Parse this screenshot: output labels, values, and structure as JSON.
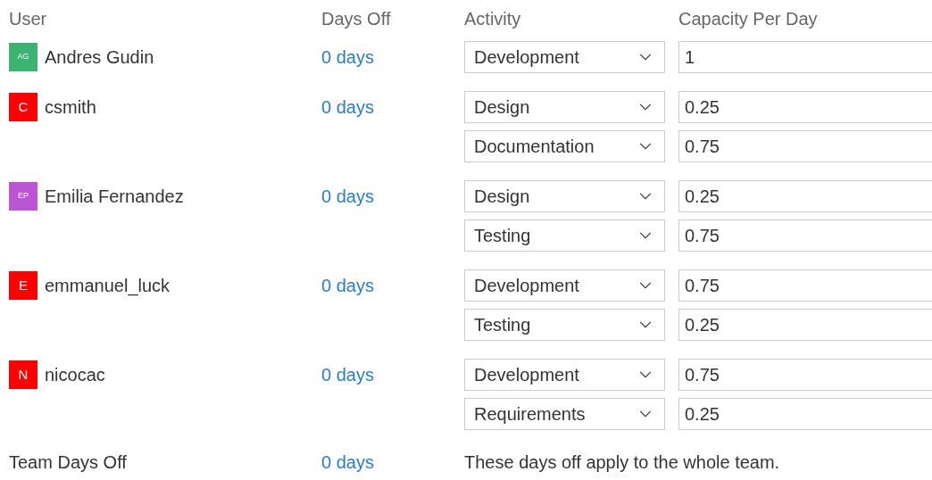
{
  "columns": [
    "User",
    "Days Off",
    "Activity",
    "Capacity Per Day"
  ],
  "members": [
    {
      "name": "Andres Gudin",
      "initials": "AG",
      "color": "#3cb371",
      "days_off": "0 days",
      "activities": [
        {
          "activity": "Development",
          "capacity": "1"
        }
      ]
    },
    {
      "name": "csmith",
      "initials": "C",
      "color": "#ff0000",
      "days_off": "0 days",
      "activities": [
        {
          "activity": "Design",
          "capacity": "0.25"
        },
        {
          "activity": "Documentation",
          "capacity": "0.75"
        }
      ]
    },
    {
      "name": "Emilia Fernandez",
      "initials": "EP",
      "color": "#bb55d3",
      "days_off": "0 days",
      "activities": [
        {
          "activity": "Design",
          "capacity": "0.25"
        },
        {
          "activity": "Testing",
          "capacity": "0.75"
        }
      ]
    },
    {
      "name": "emmanuel_luck",
      "initials": "E",
      "color": "#ff0000",
      "days_off": "0 days",
      "activities": [
        {
          "activity": "Development",
          "capacity": "0.75"
        },
        {
          "activity": "Testing",
          "capacity": "0.25"
        }
      ]
    },
    {
      "name": "nicocac",
      "initials": "N",
      "color": "#ff0000",
      "days_off": "0 days",
      "activities": [
        {
          "activity": "Development",
          "capacity": "0.75"
        },
        {
          "activity": "Requirements",
          "capacity": "0.25"
        }
      ]
    }
  ],
  "team": {
    "label": "Team Days Off",
    "days_off": "0 days",
    "note": "These days off apply to the whole team."
  }
}
